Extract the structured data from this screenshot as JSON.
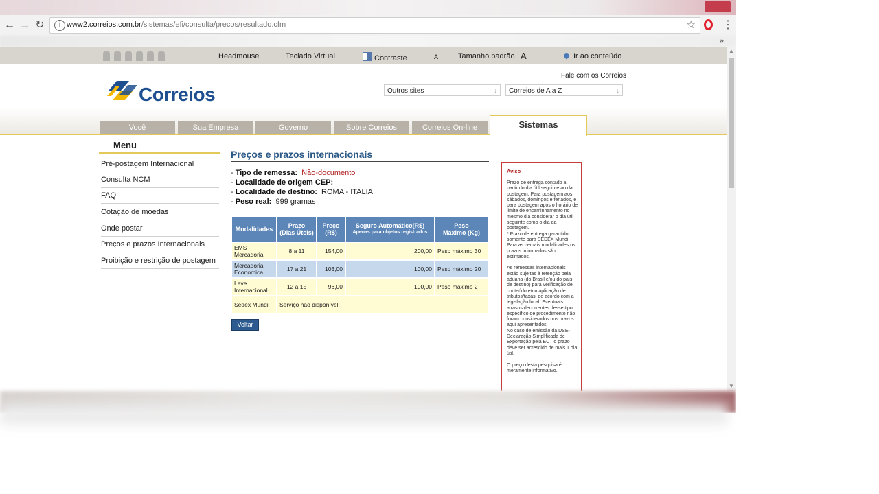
{
  "browser": {
    "url_host": "www2.correios.com.br",
    "url_path": "/sistemas/efi/consulta/precos/resultado.cfm",
    "more_bookmarks": "»"
  },
  "accessibility": {
    "headmouse": "Headmouse",
    "teclado": "Teclado Virtual",
    "contraste": "Contraste",
    "font_small": "A",
    "tamanho": "Tamanho padrão",
    "font_large": "A",
    "ir_conteudo": "Ir ao conteúdo"
  },
  "header": {
    "fale": "Fale com os Correios",
    "logo_text": "Correios",
    "select_outros": "Outros sites",
    "select_az": "Correios de A a Z",
    "tabs": [
      "Você",
      "Sua Empresa",
      "Governo",
      "Sobre Correios",
      "Correios On-line"
    ],
    "active_tab": "Sistemas"
  },
  "menu": {
    "title": "Menu",
    "items": [
      "Pré-postagem Internacional",
      "Consulta NCM",
      "FAQ",
      "Cotação de moedas",
      "Onde postar",
      "Preços e prazos Internacionais",
      "Proibição e restrição de postagem"
    ]
  },
  "main": {
    "title": "Preços e prazos internacionais",
    "tipo_label": "Tipo de remessa:",
    "tipo_value": "Não-documento",
    "origem_label": "Localidade de origem CEP:",
    "destino_label": "Localidade de destino:",
    "destino_value": "ROMA - ITALIA",
    "peso_label": "Peso real:",
    "peso_value": "999 gramas",
    "headers": {
      "modalidades": "Modalidades",
      "prazo": "Prazo",
      "prazo_sub": "(Dias Úteis)",
      "preco": "Preço",
      "preco_sub": "(R$)",
      "seguro": "Seguro Automático(R$)",
      "seguro_sub": "Apenas para objetos registrados",
      "peso": "Peso",
      "peso_sub": "Máximo (Kg)"
    },
    "rows": [
      {
        "modalidade": "EMS Mercadoria",
        "prazo": "8 a 11",
        "preco": "154,00",
        "seguro": "200,00",
        "peso": "Peso máximo 30"
      },
      {
        "modalidade": "Mercadoria Economica",
        "prazo": "17 a 21",
        "preco": "103,00",
        "seguro": "100,00",
        "peso": "Peso máximo 20"
      },
      {
        "modalidade": "Leve Internacional",
        "prazo": "12 a 15",
        "preco": "96,00",
        "seguro": "100,00",
        "peso": "Peso máximo 2"
      }
    ],
    "sedex": {
      "modalidade": "Sedex Mundi",
      "status": "Serviço não disponível!"
    },
    "voltar": "Voltar"
  },
  "aviso": {
    "title": "Aviso",
    "text": "Prazo de entrega contado a partir do dia útil seguinte ao da postagem. Para postagem aos sábados, domingos e feriados, e para postagem após o horário de limite de encaminhamento no mesmo dia considerar o dia útil seguinte como o dia da postagem.\n* Prazo de entrega garantido somente para SEDEX Mundi. Para as demais modalidades os prazos informados são estimados.\n\nAs remessas internacionais estão sujeitas à retenção pela aduana (do Brasil e/ou do país de destino) para verificação de conteúdo e/ou aplicação de tributos/taxas, de acordo com a legislação local. Eventuais atrasos decorrentes desse tipo específico de procedimento não foram considerados nos prazos aqui apresentados.\nNo caso de emissão da DSE-Declaração Simplificada de Exportação pela ECT o prazo deve ser acrescido de mais 1 dia útil.\n\nO preço desta pesquisa é meramente informativo."
  },
  "colors": {
    "brand_blue": "#1d4f91",
    "gold": "#e3c95a",
    "table_header": "#5c86b8",
    "row_yellow": "#fffbd2",
    "row_blue": "#c6d8ec",
    "alert_red": "#b22222"
  }
}
